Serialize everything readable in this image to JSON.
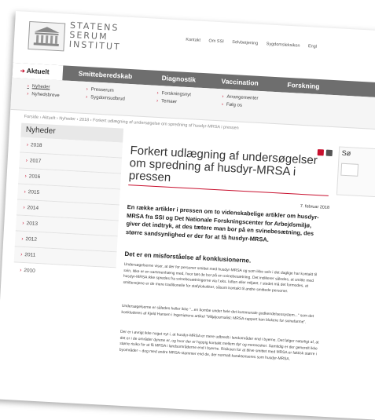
{
  "brand": {
    "line1": "STATENS",
    "line2": "SERUM",
    "line3": "INSTITUT"
  },
  "toplinks": [
    "Kontakt",
    "Om SSI",
    "Selvbetjening",
    "Sygdomsleksikon",
    "Engl"
  ],
  "nav": {
    "active": "Aktuelt",
    "tabs": [
      "Smitteberedskab",
      "Diagnostik",
      "Vaccination",
      "Forskning"
    ]
  },
  "subnav": {
    "col1": [
      "Nyheder",
      "Nyhedsbreve"
    ],
    "col2": [
      "Presserum",
      "Sygdomsudbrud"
    ],
    "col3": [
      "Forskningsnyt",
      "Temaer"
    ],
    "col4": [
      "Arrangementer",
      "Følg os"
    ]
  },
  "breadcrumb": "Forside  ›  Aktuelt  ›  Nyheder  ›  2018  ›  Forkert udlægning af undersøgelse om spredning af husdyr-MRSA i pressen",
  "sidebar": {
    "heading": "Nyheder",
    "years": [
      "2018",
      "2017",
      "2016",
      "2015",
      "2014",
      "2013",
      "2012",
      "2011",
      "2010"
    ]
  },
  "article": {
    "title": "Forkert udlægning af undersøgelser om spredning af husdyr-MRSA i pressen",
    "date": "7. februar 2018",
    "lead": "En række artikler i pressen om to videnskabelige artikler om husdyr-MRSA fra SSI og Det Nationale Forskningscenter for Arbejdsmiljø, giver det indtryk, at des tætere man bor på en svinebesætning, des større sandsynlighed er der for at få husdyr-MRSA.",
    "subheading": "Det er en misforståelse af konklusionerne.",
    "p1": "Undersøgelserne viser, at der for personer smittet med husdyr-MRSA og som ikke selv i det daglige har kontakt til svin, ikke er en sammenhæng med, hvor tæt de bor på en svinebesætning. Det indikerer således, at smitte med husdyr-MRSA ikke spredes fra svinebesætningerne via f.eks. luften eller miljøet. I stedet må det formodes, at smittevejene er de mere traditionelle for stafylokokker, såsom kontakt til andre smittede personer.",
    "p2": "Undersøgelserne er således heller ikke \"...en bombe under hele det kommunale godkendelsessystem...\" som det konkluderes af Kjeld Hansen i Ingeniørens artikel \"Miljøjournalist: MRSA-rapport kan blokere for svinefarme\".",
    "p3": "Der er i øvrigt ikke noget nyt i, at husdyr-MRSA er mere udbredt i landområder end i byerne. Det følger naturligt af, at det er i de områder dyrene er, og hvor der er hyppig kontakt mellem dyr og mennesker. Samtidig er der generelt ikke større risiko for at få MRSA i landsområderne end i byerne. Risikoen for at blive smittet med MRSA er faktisk større i byområder – dog med andre MRSA-stammer end de, der normalt karakteriseres som husdyr-MRSA."
  },
  "right_panel": {
    "label": "Sø"
  },
  "colors": {
    "accent": "#c8102e",
    "nav": "#6e6e6e"
  }
}
